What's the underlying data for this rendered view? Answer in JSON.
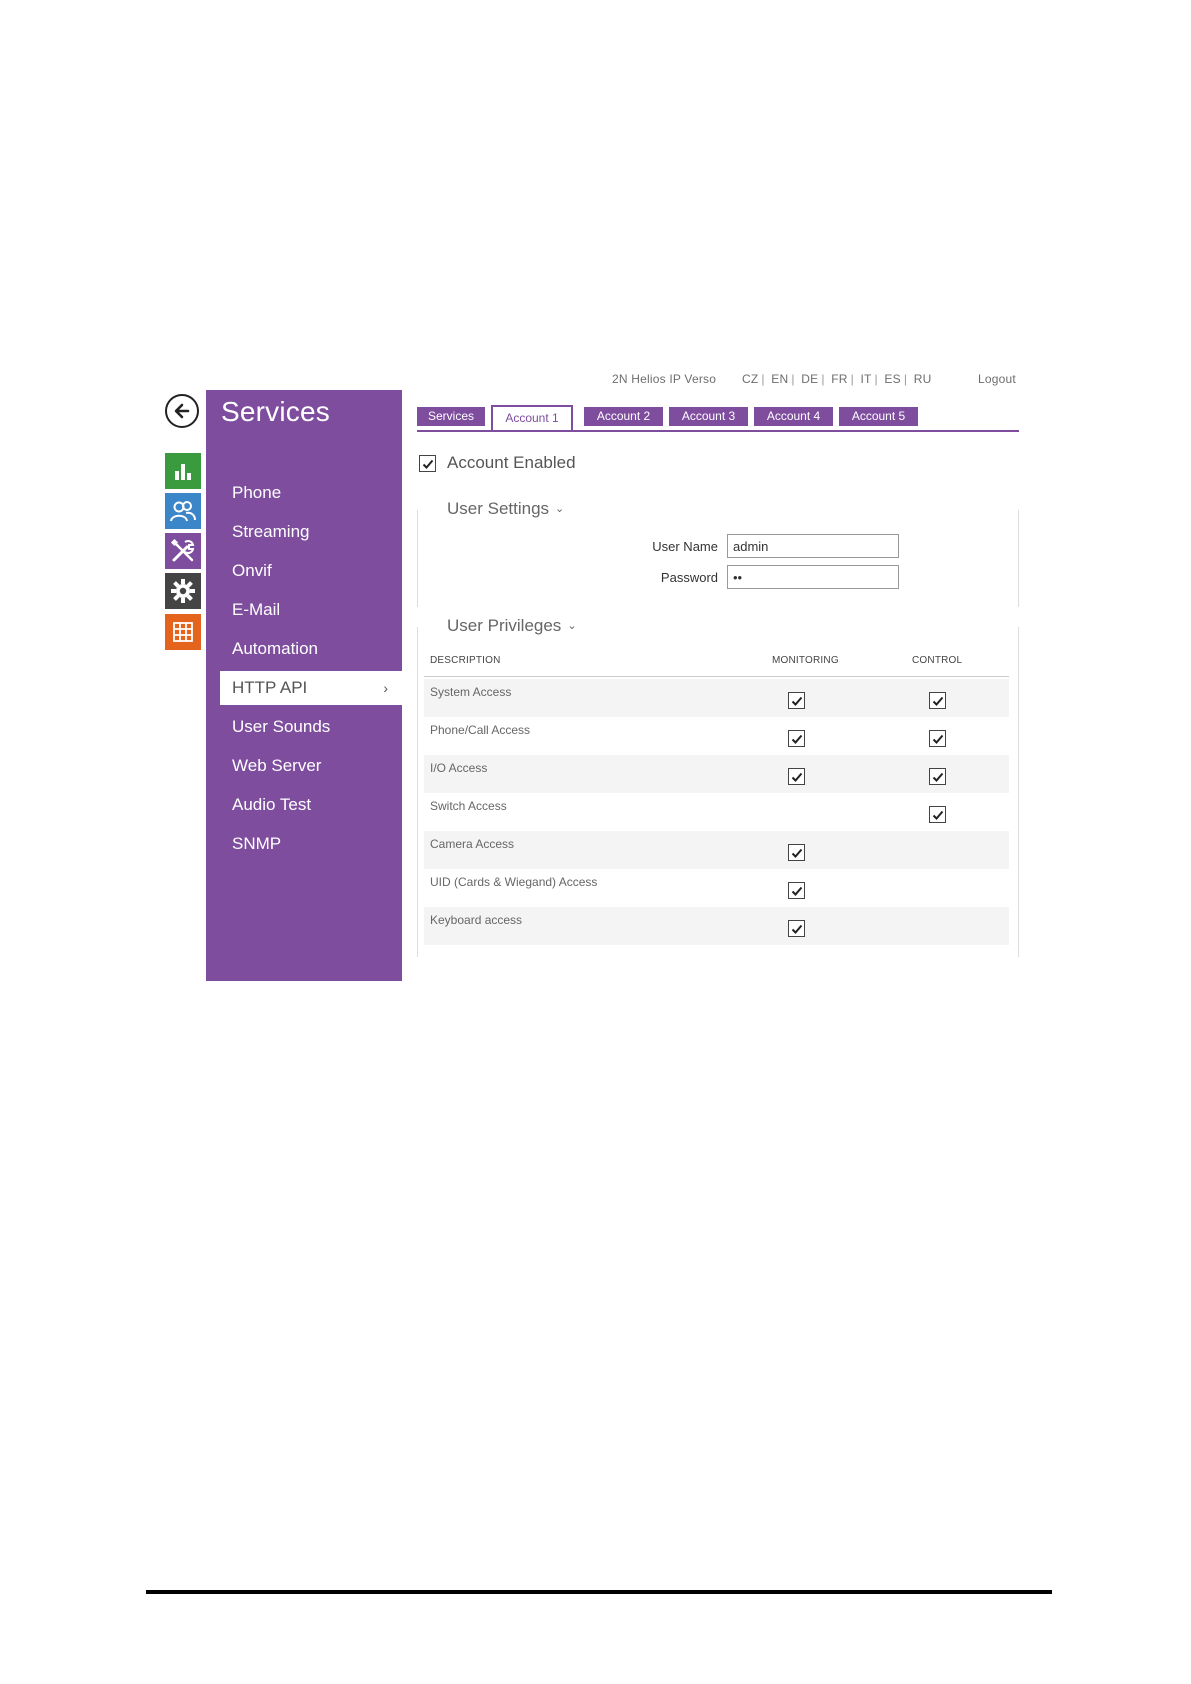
{
  "topbar": {
    "device": "2N Helios IP Verso",
    "languages": [
      "CZ",
      "EN",
      "DE",
      "FR",
      "IT",
      "ES",
      "RU"
    ],
    "logout": "Logout"
  },
  "left_icons": [
    "back-arrow-icon",
    "status-chart-icon",
    "directory-users-icon",
    "hardware-tools-icon",
    "system-gear-icon",
    "services-grid-icon"
  ],
  "left_icon_colors": [
    "#3a9a3e",
    "#3a86c8",
    "#7e4d9e",
    "#444444",
    "#e5641d"
  ],
  "sidebar": {
    "title": "Services",
    "items": [
      {
        "label": "Phone"
      },
      {
        "label": "Streaming"
      },
      {
        "label": "Onvif"
      },
      {
        "label": "E-Mail"
      },
      {
        "label": "Automation"
      },
      {
        "label": "HTTP API",
        "active": true
      },
      {
        "label": "User Sounds"
      },
      {
        "label": "Web Server"
      },
      {
        "label": "Audio Test"
      },
      {
        "label": "SNMP"
      }
    ]
  },
  "tabs": [
    {
      "label": "Services"
    },
    {
      "label": "Account 1",
      "active": true
    },
    {
      "label": "Account 2"
    },
    {
      "label": "Account 3"
    },
    {
      "label": "Account 4"
    },
    {
      "label": "Account 5"
    }
  ],
  "account": {
    "enabled_label": "Account Enabled",
    "enabled": true
  },
  "user_settings": {
    "title": "User Settings",
    "username_label": "User Name",
    "username_value": "admin",
    "password_label": "Password",
    "password_value": "••"
  },
  "privileges": {
    "title": "User Privileges",
    "columns": [
      "DESCRIPTION",
      "MONITORING",
      "CONTROL"
    ],
    "rows": [
      {
        "label": "System Access",
        "monitoring": true,
        "control": true
      },
      {
        "label": "Phone/Call Access",
        "monitoring": true,
        "control": true
      },
      {
        "label": "I/O Access",
        "monitoring": true,
        "control": true
      },
      {
        "label": "Switch Access",
        "monitoring": false,
        "control": true
      },
      {
        "label": "Camera Access",
        "monitoring": true,
        "control": false
      },
      {
        "label": "UID (Cards & Wiegand) Access",
        "monitoring": true,
        "control": false
      },
      {
        "label": "Keyboard access",
        "monitoring": true,
        "control": false
      }
    ]
  },
  "colors": {
    "accent": "#7e4d9e",
    "status": "#3a9a3e",
    "directory": "#3a86c8",
    "system": "#444444",
    "services": "#e5641d"
  }
}
